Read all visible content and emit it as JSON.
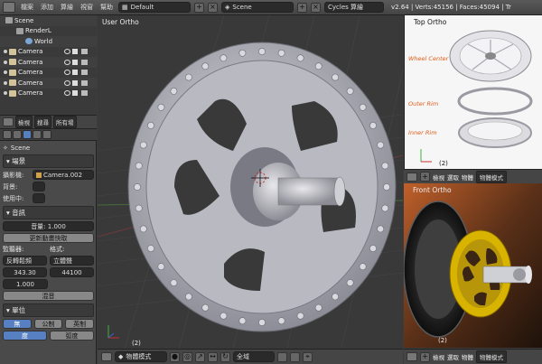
{
  "topbar": {
    "menus": [
      "檔案",
      "添加",
      "算繪",
      "視窗",
      "幫助"
    ],
    "layout": "Default",
    "scene": "Scene",
    "engine": "Cycles 算繪",
    "stats": "v2.64 | Verts:45156 | Faces:45094 | Tr"
  },
  "outliner": {
    "items": [
      {
        "label": "Scene"
      },
      {
        "label": "RenderL"
      },
      {
        "label": "World"
      },
      {
        "label": "Camera"
      },
      {
        "label": "Camera"
      },
      {
        "label": "Camera"
      },
      {
        "label": "Camera"
      },
      {
        "label": "Camera"
      }
    ],
    "footer": {
      "view": "檢視",
      "search": "搜尋",
      "all": "所有場"
    }
  },
  "properties": {
    "context": "Scene",
    "scene_section": "場景",
    "camera_label": "攝影機:",
    "camera_value": "Camera.002",
    "background_label": "背景:",
    "active_label": "使用中:",
    "audio_section": "音訊",
    "volume": "音量: 1.000",
    "update_anim": "更新動畫快取",
    "listener_label": "監聽器:",
    "format_label": "格式:",
    "listener_value": "反轉鬆頻",
    "format_value": "立體聲",
    "distance": "343.30",
    "rate": "44100",
    "doppler": "1.000",
    "mixdown": "混音",
    "units_section": "單位",
    "units": [
      "無",
      "公制",
      "英制"
    ],
    "degrees": [
      "度",
      "弧度"
    ]
  },
  "viewport": {
    "title": "User Ortho",
    "frame": "(2)",
    "mode": "物體模式",
    "pivot": "全域"
  },
  "top_ortho": {
    "title": "Top Ortho",
    "frame": "(2)",
    "labels": [
      "Wheel Center",
      "Outer Rim",
      "Inner Rim"
    ],
    "menu": [
      "檢視",
      "選取",
      "物體"
    ],
    "mode": "物體模式"
  },
  "front_ortho": {
    "title": "Front Ortho",
    "frame": "(2)",
    "menu": [
      "檢視",
      "選取",
      "物體"
    ],
    "mode": "物體模式"
  },
  "colors": {
    "accent": "#5680c2",
    "rim_label": "#e25c1a",
    "gold": "#d8b400"
  }
}
